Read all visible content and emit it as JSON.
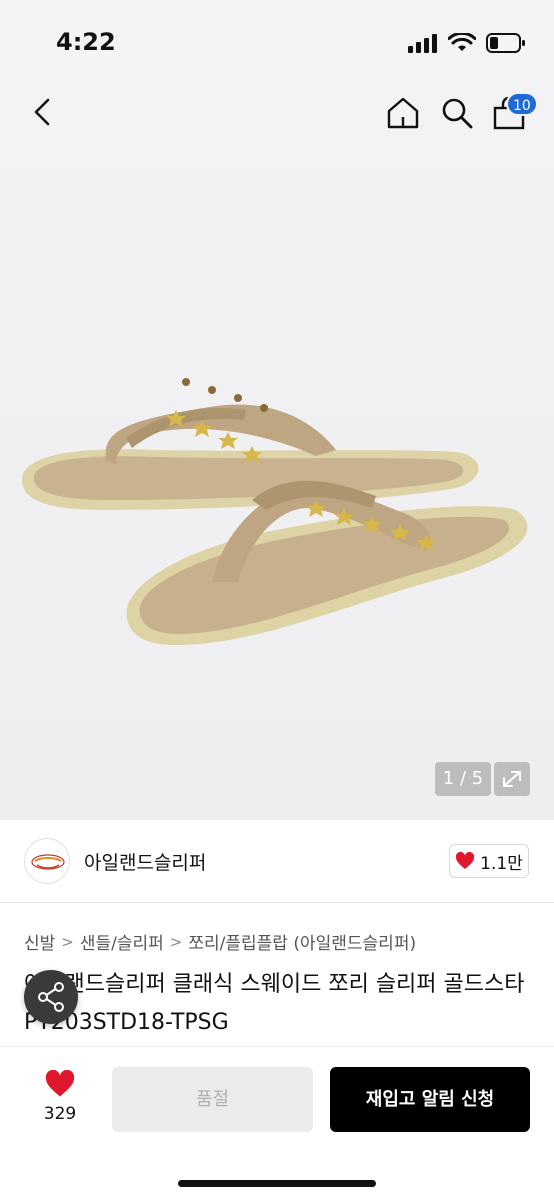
{
  "status_bar": {
    "time": "4:22"
  },
  "nav": {
    "cart_count": "10"
  },
  "gallery": {
    "counter": "1 / 5"
  },
  "brand": {
    "name": "아일랜드슬리퍼",
    "likes": "1.1만"
  },
  "breadcrumb": [
    "신발",
    "샌들/슬리퍼",
    "쪼리/플립플랍 (아일랜드슬리퍼)"
  ],
  "product": {
    "title": "아일랜드슬리퍼 클래식 스웨이드 쪼리 슬리퍼 골드스타 PT203STD18-TPSG"
  },
  "bottom_bar": {
    "wish_count": "329",
    "soldout_label": "품절",
    "restock_label": "재입고 알림 신청"
  },
  "colors": {
    "accent": "#1f6ad6",
    "heart": "#e0182d",
    "cta": "#000000"
  },
  "icons": [
    "back-icon",
    "home-icon",
    "search-icon",
    "shopping-bag-icon",
    "expand-icon",
    "heart-icon",
    "share-icon"
  ]
}
